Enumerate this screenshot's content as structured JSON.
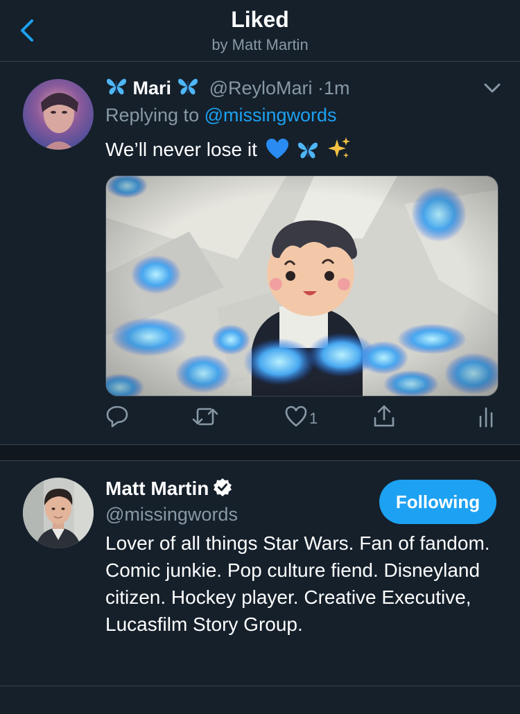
{
  "header": {
    "title": "Liked",
    "subtitle": "by Matt Martin"
  },
  "tweet": {
    "display_name": "Mari",
    "handle": "@ReyloMari",
    "separator": "·",
    "time": "1m",
    "replying_prefix": "Replying to",
    "replying_mention": "@missingwords",
    "text": "We’ll never lose it",
    "like_count": "1"
  },
  "profile": {
    "name": "Matt Martin",
    "handle": "@missingwords",
    "follow_label": "Following",
    "bio": "Lover of all things Star Wars. Fan of fandom. Comic junkie. Pop culture fiend. Disneyland citizen. Hockey player. Creative Executive, Lucasfilm Story Group."
  },
  "colors": {
    "background": "#15202b",
    "accent": "#1da1f2",
    "secondary_text": "#8899a6",
    "divider": "#38444d"
  },
  "icons": {
    "back": "chevron-left-icon",
    "caret": "chevron-down-icon",
    "reply": "reply-icon",
    "retweet": "retweet-icon",
    "like": "heart-icon",
    "share": "share-icon",
    "analytics": "analytics-icon",
    "verified": "verified-badge-icon"
  }
}
